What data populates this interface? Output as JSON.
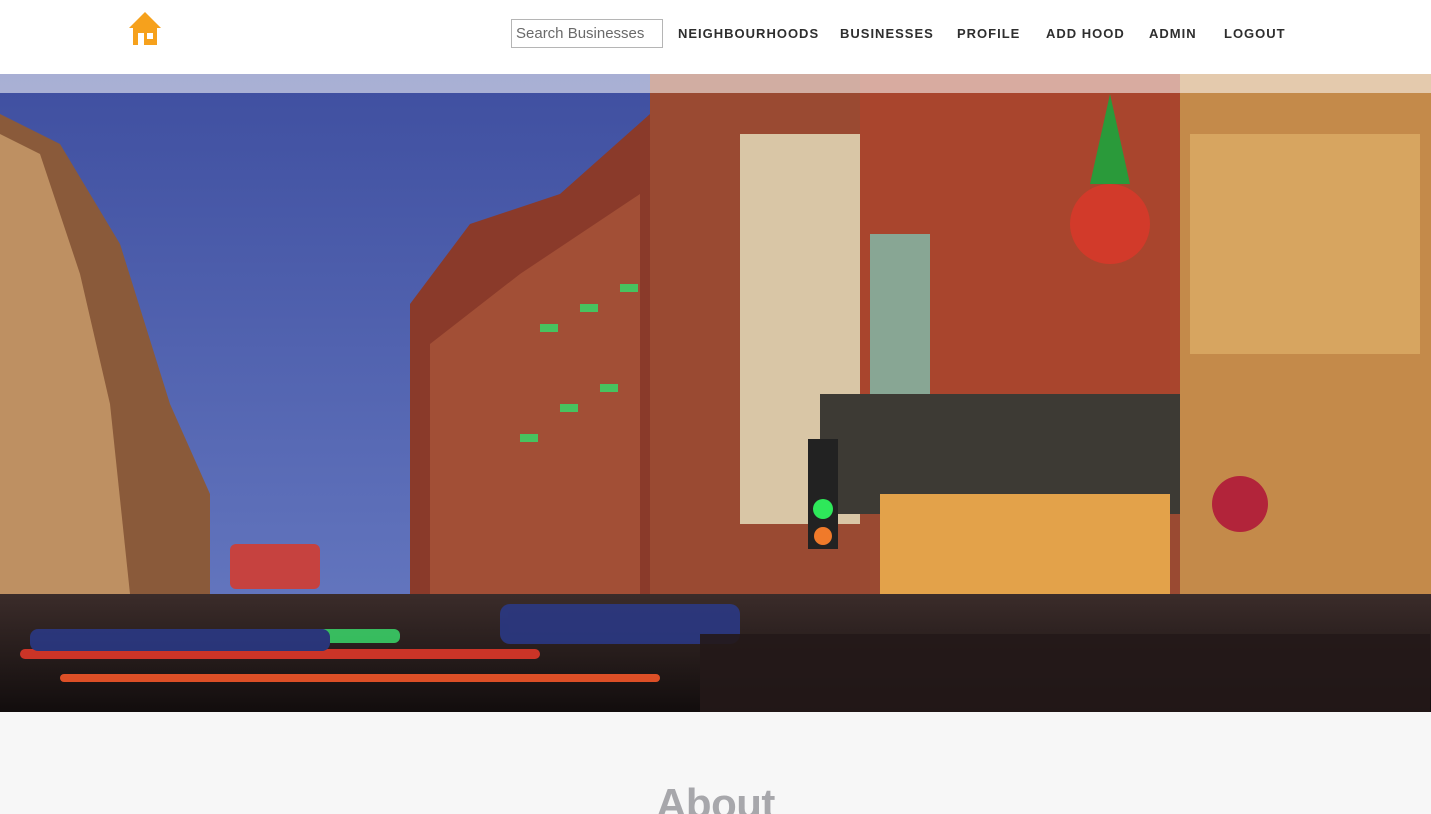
{
  "colors": {
    "accent": "#f6a11c",
    "nav_text": "#2e2e2e",
    "about_title": "#a7a7ab"
  },
  "header": {
    "logo_icon": "house-icon",
    "search": {
      "placeholder": "Search Businesses",
      "value": ""
    },
    "nav": [
      {
        "key": "neighbourhoods",
        "label": "NEIGHBOURHOODS"
      },
      {
        "key": "businesses",
        "label": "BUSINESSES"
      },
      {
        "key": "profile",
        "label": "PROFILE"
      },
      {
        "key": "add-hood",
        "label": "ADD HOOD"
      },
      {
        "key": "admin",
        "label": "ADMIN"
      },
      {
        "key": "logout",
        "label": "LOGOUT"
      }
    ]
  },
  "hero": {
    "image": "city-street-night-photo"
  },
  "about": {
    "title": "About"
  }
}
